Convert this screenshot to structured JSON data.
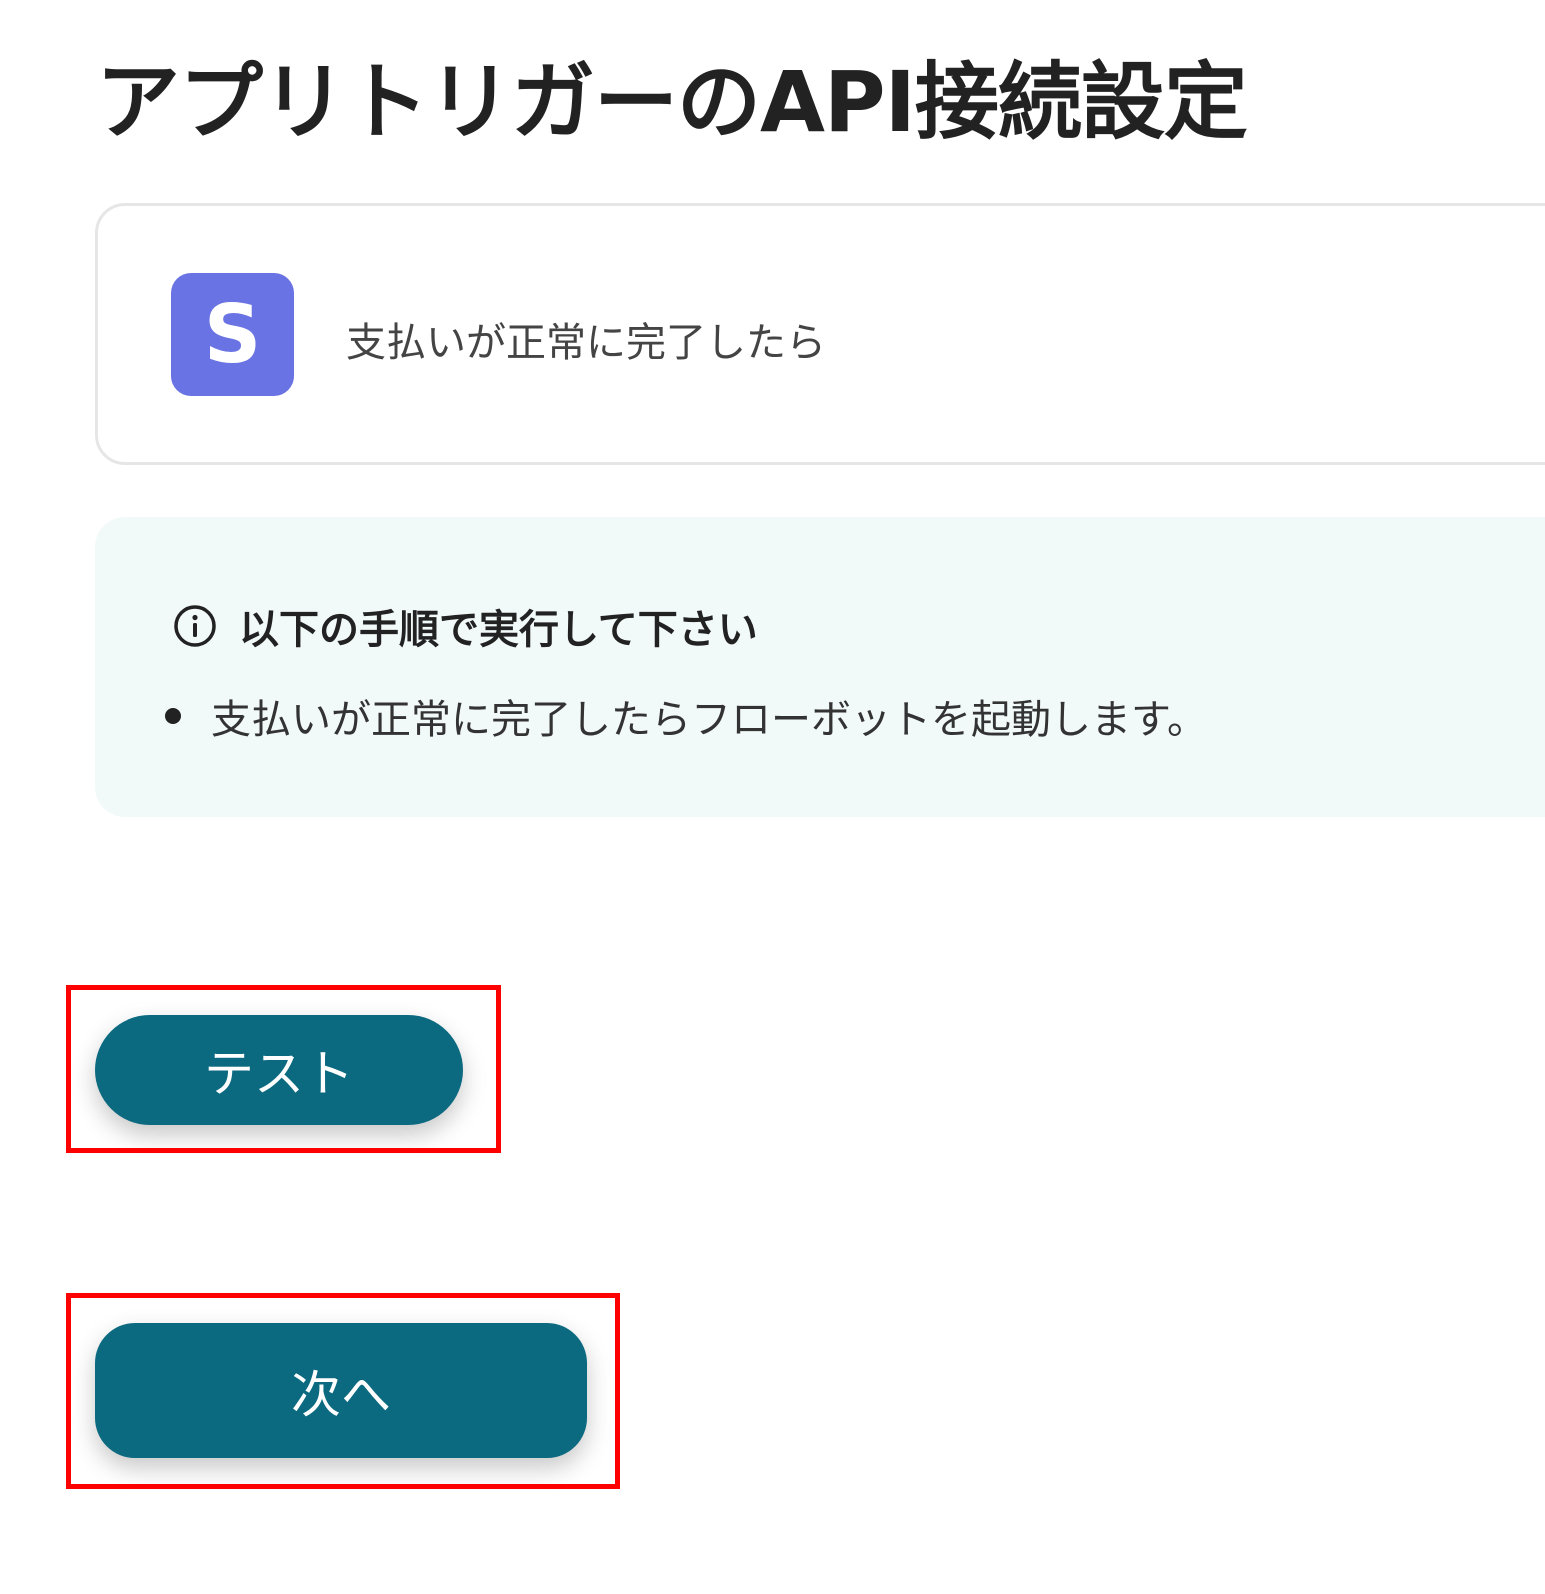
{
  "page": {
    "title": "アプリトリガーのAPI接続設定"
  },
  "trigger": {
    "app_logo_letter": "S",
    "app_logo_color": "#6a73e3",
    "name": "支払いが正常に完了したら"
  },
  "info": {
    "icon": "info-circle-icon",
    "heading": "以下の手順で実行して下さい",
    "items": [
      "支払いが正常に完了したらフローボットを起動します。"
    ]
  },
  "buttons": {
    "test_label": "テスト",
    "next_label": "次へ",
    "color": "#0b6a80"
  },
  "annotations": {
    "highlight_color": "#ff0000"
  }
}
